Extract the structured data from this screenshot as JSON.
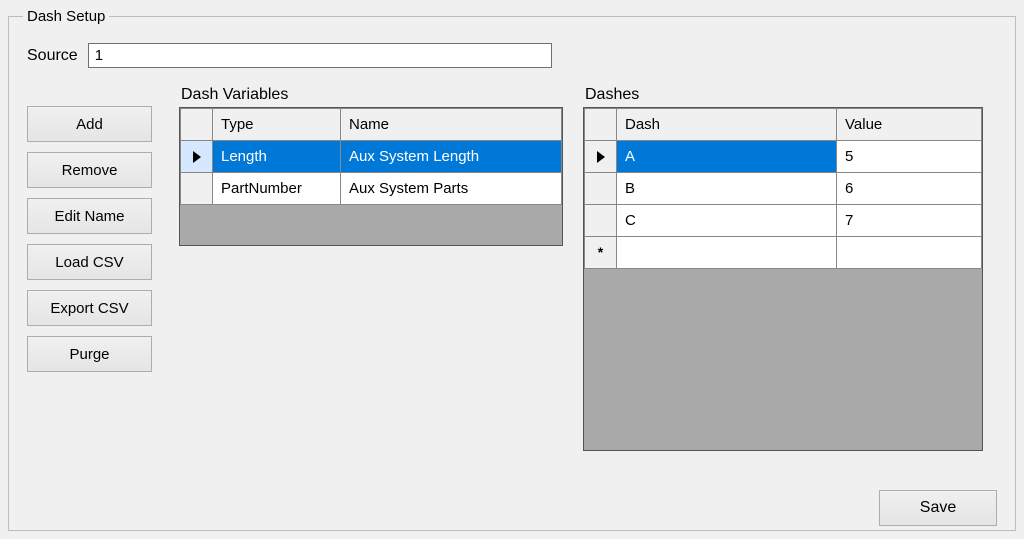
{
  "group": {
    "title": "Dash Setup"
  },
  "source": {
    "label": "Source",
    "value": "1"
  },
  "buttons": {
    "add": "Add",
    "remove": "Remove",
    "edit_name": "Edit Name",
    "load_csv": "Load CSV",
    "export_csv": "Export CSV",
    "purge": "Purge"
  },
  "vars": {
    "title": "Dash Variables",
    "headers": {
      "type": "Type",
      "name": "Name"
    },
    "rows": [
      {
        "type": "Length",
        "name": "Aux System Length",
        "selected": true
      },
      {
        "type": "PartNumber",
        "name": "Aux System Parts",
        "selected": false
      }
    ]
  },
  "dashes": {
    "title": "Dashes",
    "headers": {
      "dash": "Dash",
      "value": "Value"
    },
    "rows": [
      {
        "dash": "A",
        "value": "5",
        "selected": true
      },
      {
        "dash": "B",
        "value": "6",
        "selected": false
      },
      {
        "dash": "C",
        "value": "7",
        "selected": false
      }
    ]
  },
  "save": {
    "label": "Save"
  }
}
